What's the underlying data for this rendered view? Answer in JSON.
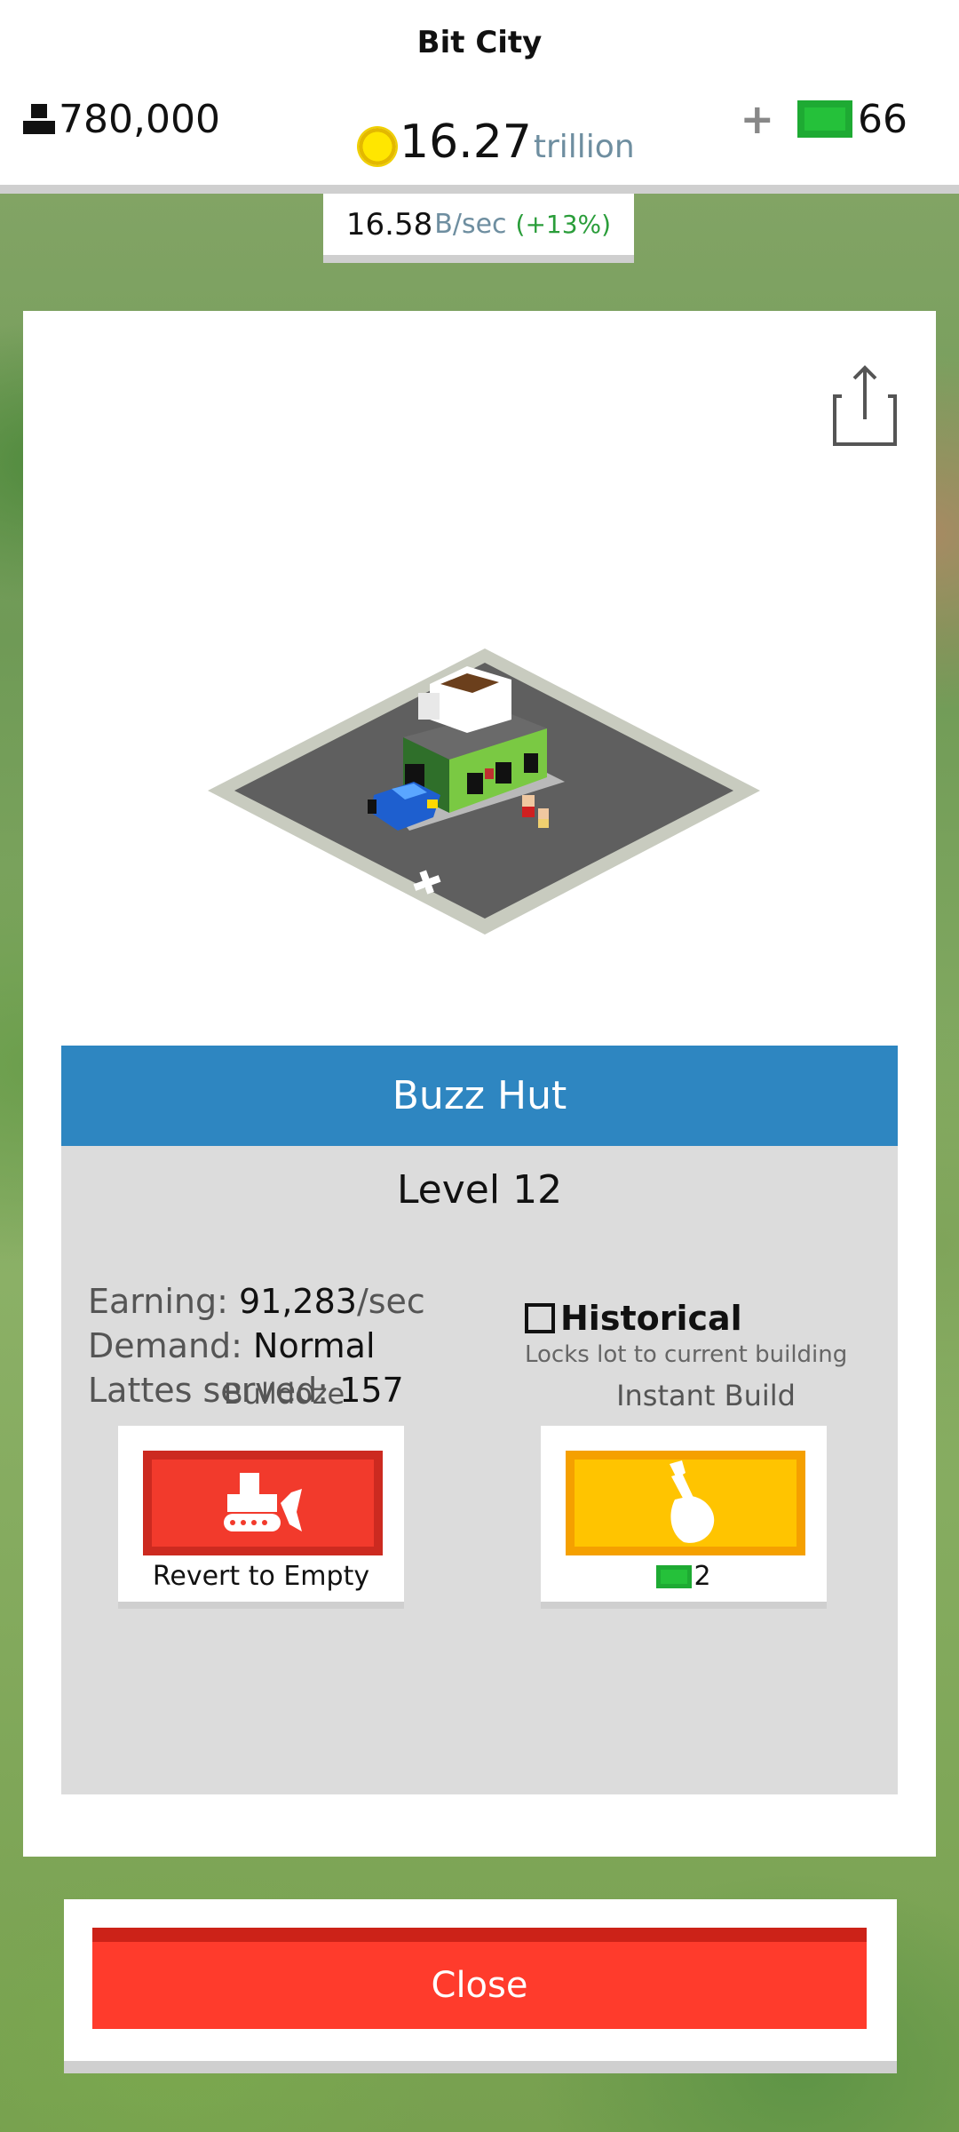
{
  "header": {
    "title": "Bit City",
    "population": "780,000",
    "cash_amount": "16.27",
    "cash_unit": "trillion",
    "bux_plus": "+",
    "bux_count": "66",
    "rate_amount": "16.58",
    "rate_unit": "B/sec",
    "rate_bonus": "(+13%)"
  },
  "building": {
    "name": "Buzz Hut",
    "level": "Level 12",
    "stats": [
      {
        "label": "Earning: ",
        "value": "91,283",
        "unit": "/sec"
      },
      {
        "label": "Demand: ",
        "value": "Normal",
        "unit": ""
      },
      {
        "label": "Lattes served: ",
        "value": "157",
        "unit": ""
      }
    ],
    "historical": {
      "label": "Historical",
      "description": "Locks lot to current building",
      "checked": false
    }
  },
  "actions": {
    "bulldoze": {
      "label": "Bulldoze",
      "caption": "Revert to Empty",
      "icon": "bulldozer-icon"
    },
    "instant_build": {
      "label": "Instant Build",
      "cost": "2",
      "icon": "hammer-icon"
    }
  },
  "close_label": "Close",
  "colors": {
    "title_bar": "#2e86c1",
    "bulldoze": "#f23a2c",
    "instant_build": "#ffc400",
    "close": "#ff3b2c",
    "bux": "#25c13a"
  }
}
